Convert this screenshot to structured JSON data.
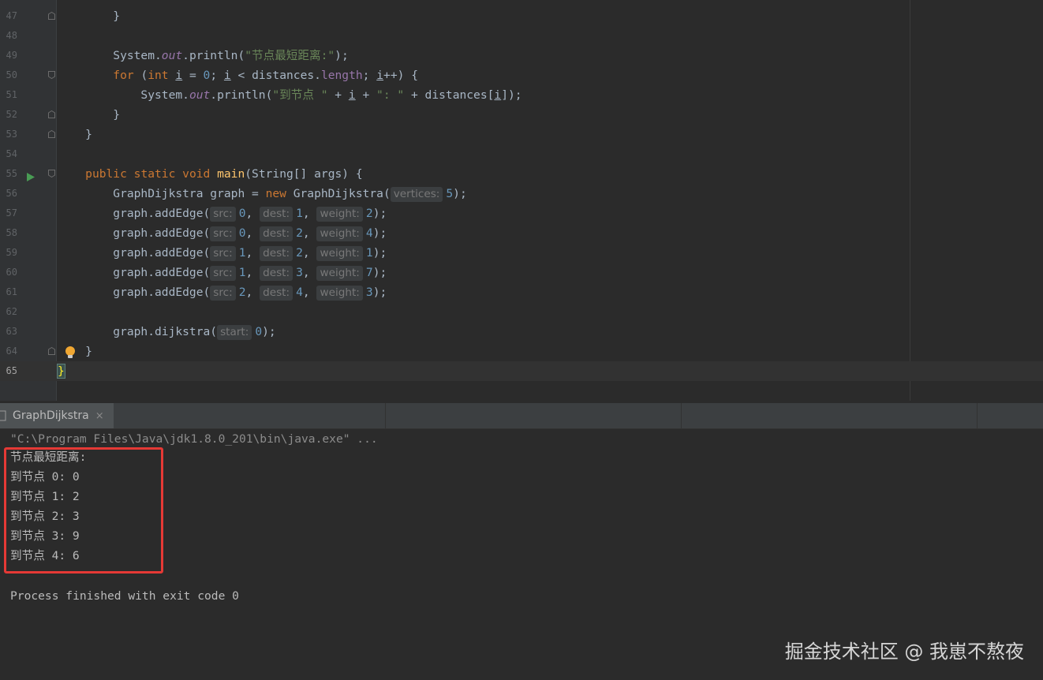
{
  "editor": {
    "lines": [
      {
        "num": "47"
      },
      {
        "num": "48"
      },
      {
        "num": "49",
        "str": "\"节点最短距离:\""
      },
      {
        "num": "50"
      },
      {
        "num": "51",
        "str1": "\"到节点 \"",
        "str2": "\": \""
      },
      {
        "num": "52"
      },
      {
        "num": "53"
      },
      {
        "num": "54"
      },
      {
        "num": "55"
      },
      {
        "num": "56",
        "hint": "vertices:",
        "arg": "5"
      },
      {
        "num": "57",
        "args": [
          "0",
          "1",
          "2"
        ]
      },
      {
        "num": "58",
        "args": [
          "0",
          "2",
          "4"
        ]
      },
      {
        "num": "59",
        "args": [
          "1",
          "2",
          "1"
        ]
      },
      {
        "num": "60",
        "args": [
          "1",
          "3",
          "7"
        ]
      },
      {
        "num": "61",
        "args": [
          "2",
          "4",
          "3"
        ]
      },
      {
        "num": "62"
      },
      {
        "num": "63",
        "hint": "start:",
        "arg": "0"
      },
      {
        "num": "64"
      },
      {
        "num": "65"
      }
    ],
    "hints": {
      "src": "src:",
      "dest": "dest:",
      "weight": "weight:"
    }
  },
  "run_panel": {
    "tab_label": "GraphDijkstra",
    "tab_close": "×",
    "command": "\"C:\\Program Files\\Java\\jdk1.8.0_201\\bin\\java.exe\" ...",
    "output": [
      "节点最短距离:",
      "到节点 0: 0",
      "到节点 1: 2",
      "到节点 2: 3",
      "到节点 3: 9",
      "到节点 4: 6"
    ],
    "exit_message": "Process finished with exit code 0"
  },
  "watermark": "掘金技术社区 @ 我崽不熬夜",
  "colors": {
    "highlight_box": "#e53935",
    "keyword": "#cc7832",
    "string": "#6a8759",
    "number": "#6897bb"
  }
}
